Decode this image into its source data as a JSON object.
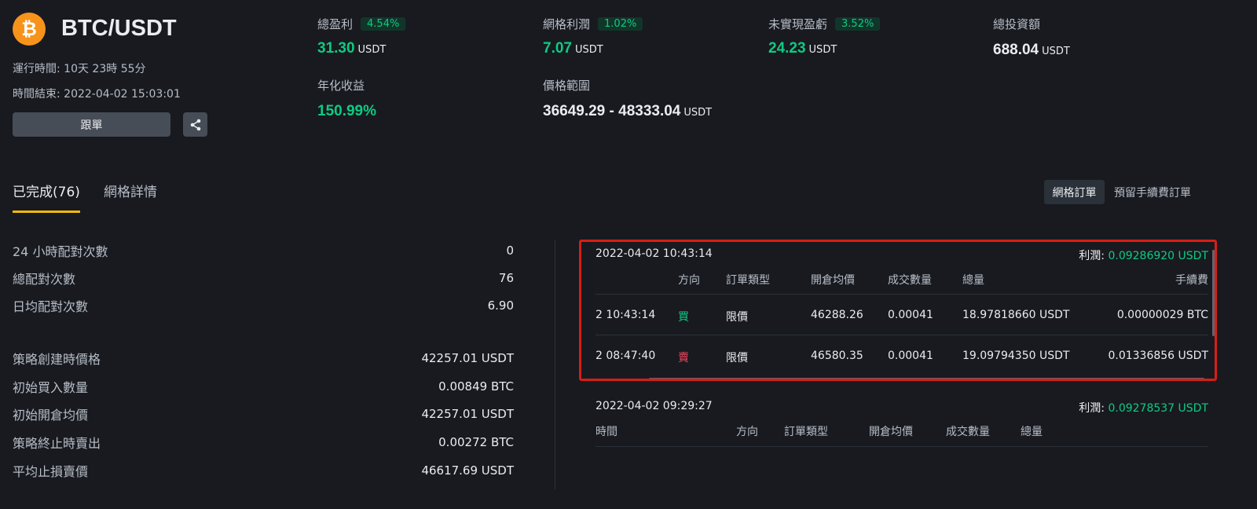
{
  "header": {
    "coin_symbol": "₿",
    "pair": "BTC/USDT",
    "runtime": "運行時間: 10天 23時 55分",
    "end_time": "時間結束: 2022-04-02 15:03:01",
    "follow_label": "跟單"
  },
  "stats": {
    "total_profit": {
      "label": "總盈利",
      "pct": "4.54%",
      "value": "31.30",
      "unit": "USDT"
    },
    "grid_profit": {
      "label": "網格利潤",
      "pct": "1.02%",
      "value": "7.07",
      "unit": "USDT"
    },
    "unrealized": {
      "label": "未實現盈虧",
      "pct": "3.52%",
      "value": "24.23",
      "unit": "USDT"
    },
    "total_investment": {
      "label": "總投資額",
      "value": "688.04",
      "unit": "USDT"
    },
    "annualized": {
      "label": "年化收益",
      "value": "150.99%"
    },
    "price_range": {
      "label": "價格範圍",
      "value": "36649.29 - 48333.04",
      "unit": "USDT"
    }
  },
  "tabs": [
    {
      "label": "已完成(76)"
    },
    {
      "label": "網格詳情"
    }
  ],
  "segments": [
    {
      "label": "網格訂單"
    },
    {
      "label": "預留手續費訂單"
    }
  ],
  "summary": [
    {
      "label": "24 小時配對次數",
      "value": "0"
    },
    {
      "label": "總配對次數",
      "value": "76"
    },
    {
      "label": "日均配對次數",
      "value": "6.90"
    },
    {
      "label": "策略創建時價格",
      "value": "42257.01 USDT"
    },
    {
      "label": "初始買入數量",
      "value": "0.00849 BTC"
    },
    {
      "label": "初始開倉均價",
      "value": "42257.01 USDT"
    },
    {
      "label": "策略終止時賣出",
      "value": "0.00272 BTC"
    },
    {
      "label": "平均止損賣價",
      "value": "46617.69 USDT"
    }
  ],
  "orders": [
    {
      "timestamp": "2022-04-02 10:43:14",
      "profit_label": "利潤:",
      "profit_value": "0.09286920 USDT",
      "columns": [
        "",
        "方向",
        "訂單類型",
        "開倉均價",
        "成交數量",
        "總量",
        "手續費"
      ],
      "rows": [
        {
          "time": "2 10:43:14",
          "side": "買",
          "type": "限價",
          "price": "46288.26",
          "qty": "0.00041",
          "total": "18.97818660 USDT",
          "fee": "0.00000029 BTC"
        },
        {
          "time": "2 08:47:40",
          "side": "賣",
          "type": "限價",
          "price": "46580.35",
          "qty": "0.00041",
          "total": "19.09794350 USDT",
          "fee": "0.01336856 USDT"
        }
      ]
    },
    {
      "timestamp": "2022-04-02 09:29:27",
      "profit_label": "利潤:",
      "profit_value": "0.09278537 USDT",
      "columns": [
        "時間",
        "方向",
        "訂單類型",
        "開倉均價",
        "成交數量",
        "總量"
      ]
    }
  ],
  "colors": {
    "buy": "#0ecb81",
    "sell": "#f6465d",
    "accent": "#f0b90b",
    "highlight": "#d81e15"
  }
}
